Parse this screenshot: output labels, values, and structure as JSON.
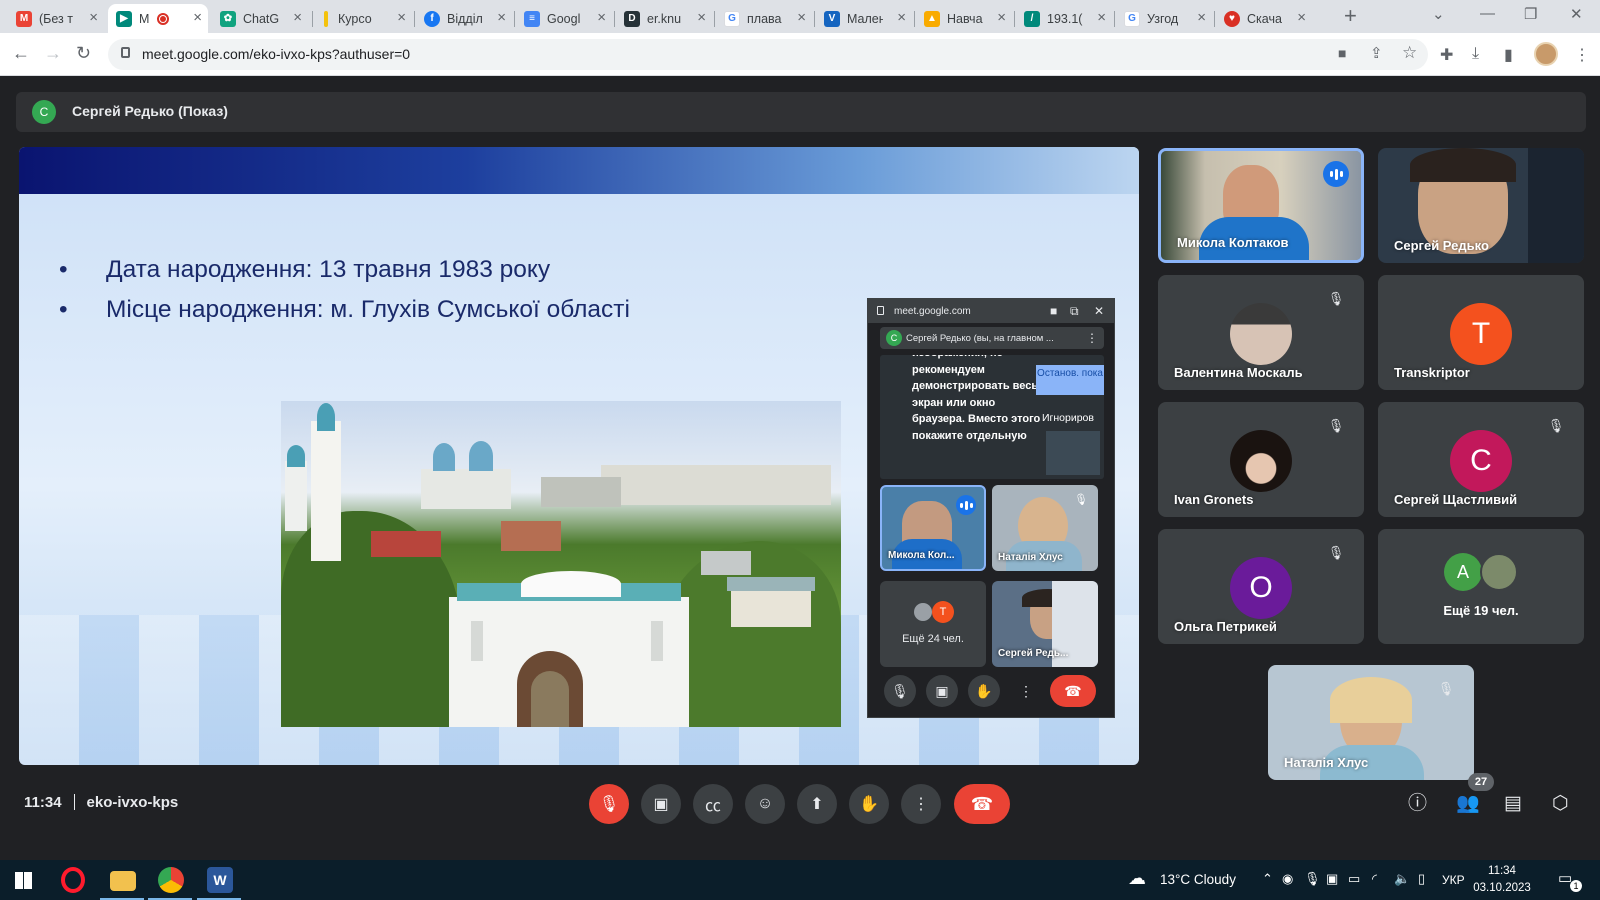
{
  "browser": {
    "tabs": [
      {
        "title": "(Без т",
        "favicon": "gmail-icon",
        "color": "#ea4335",
        "active": false
      },
      {
        "title": "M",
        "favicon": "meet-icon",
        "color": "#00897b",
        "active": true,
        "recording": true
      },
      {
        "title": "ChatG",
        "favicon": "chatgpt-icon",
        "color": "#10a37f",
        "active": false
      },
      {
        "title": "Курсо",
        "favicon": "note-icon",
        "color": "#f4c20d",
        "active": false
      },
      {
        "title": "Відділ",
        "favicon": "facebook-icon",
        "color": "#1877f2",
        "active": false
      },
      {
        "title": "Googl",
        "favicon": "google-docs-icon",
        "color": "#4285f4",
        "active": false
      },
      {
        "title": "er.knu",
        "favicon": "d-icon",
        "color": "#263238",
        "active": false
      },
      {
        "title": "плава",
        "favicon": "google-icon",
        "color": "#4285f4",
        "active": false
      },
      {
        "title": "Мален",
        "favicon": "vector-icon",
        "color": "#1565c0",
        "active": false
      },
      {
        "title": "Навча",
        "favicon": "bell-icon",
        "color": "#f9ab00",
        "active": false
      },
      {
        "title": "193.1(",
        "favicon": "chart-icon",
        "color": "#00897b",
        "active": false
      },
      {
        "title": "Узгод",
        "favicon": "google-icon",
        "color": "#4285f4",
        "active": false
      },
      {
        "title": "Скача",
        "favicon": "heart-icon",
        "color": "#d93025",
        "active": false
      }
    ],
    "url": "meet.google.com/eko-ivxo-kps?authuser=0"
  },
  "presenter": {
    "initial": "С",
    "label": "Сергей Редько (Показ)"
  },
  "slide": {
    "bullets": [
      "Дата народження: 13 травня 1983 року",
      "Місце народження: м. Глухів Сумської області"
    ]
  },
  "pip": {
    "domain": "meet.google.com",
    "presenter_initial": "С",
    "presenter_label": "Сергей Редько (вы, на главном ...",
    "share_warning": "изображения, не рекомендуем демонстрировать весь экран или окно браузера. Вместо этого покажите отдельную",
    "stop_label": "Останов. пока",
    "ignore_label": "Игнориров",
    "tiles": [
      {
        "name": "Микола Кол...",
        "speaking": true
      },
      {
        "name": "Наталія Хлус",
        "muted": true
      },
      {
        "name": "Ещё 24 чел.",
        "avatar": "Т"
      },
      {
        "name": "Сергей Редь..."
      }
    ]
  },
  "participants": [
    {
      "name": "Микола Колтаков",
      "type": "video",
      "speaking": true
    },
    {
      "name": "Сергей Редько",
      "type": "video"
    },
    {
      "name": "Валентина Москаль",
      "type": "photo",
      "muted": true
    },
    {
      "name": "Transkriptor",
      "type": "initial",
      "initial": "T",
      "color": "#f4511e"
    },
    {
      "name": "Ivan Gronets",
      "type": "photo",
      "muted": true
    },
    {
      "name": "Сергей Щастливий",
      "type": "initial",
      "initial": "С",
      "color": "#c2185b",
      "muted": true
    },
    {
      "name": "Ольга Петрикей",
      "type": "initial",
      "initial": "О",
      "color": "#6a1b9a",
      "muted": true
    },
    {
      "name": "Ещё 19 чел.",
      "type": "more",
      "initial": "А",
      "color": "#43a047"
    },
    {
      "name": "Наталія Хлус",
      "type": "video",
      "muted": true
    }
  ],
  "meeting": {
    "time": "11:34",
    "code": "eko-ivxo-kps",
    "people_count": "27"
  },
  "taskbar": {
    "weather": "13°C  Cloudy",
    "lang": "УКР",
    "time": "11:34",
    "date": "03.10.2023",
    "notifications": "1"
  }
}
